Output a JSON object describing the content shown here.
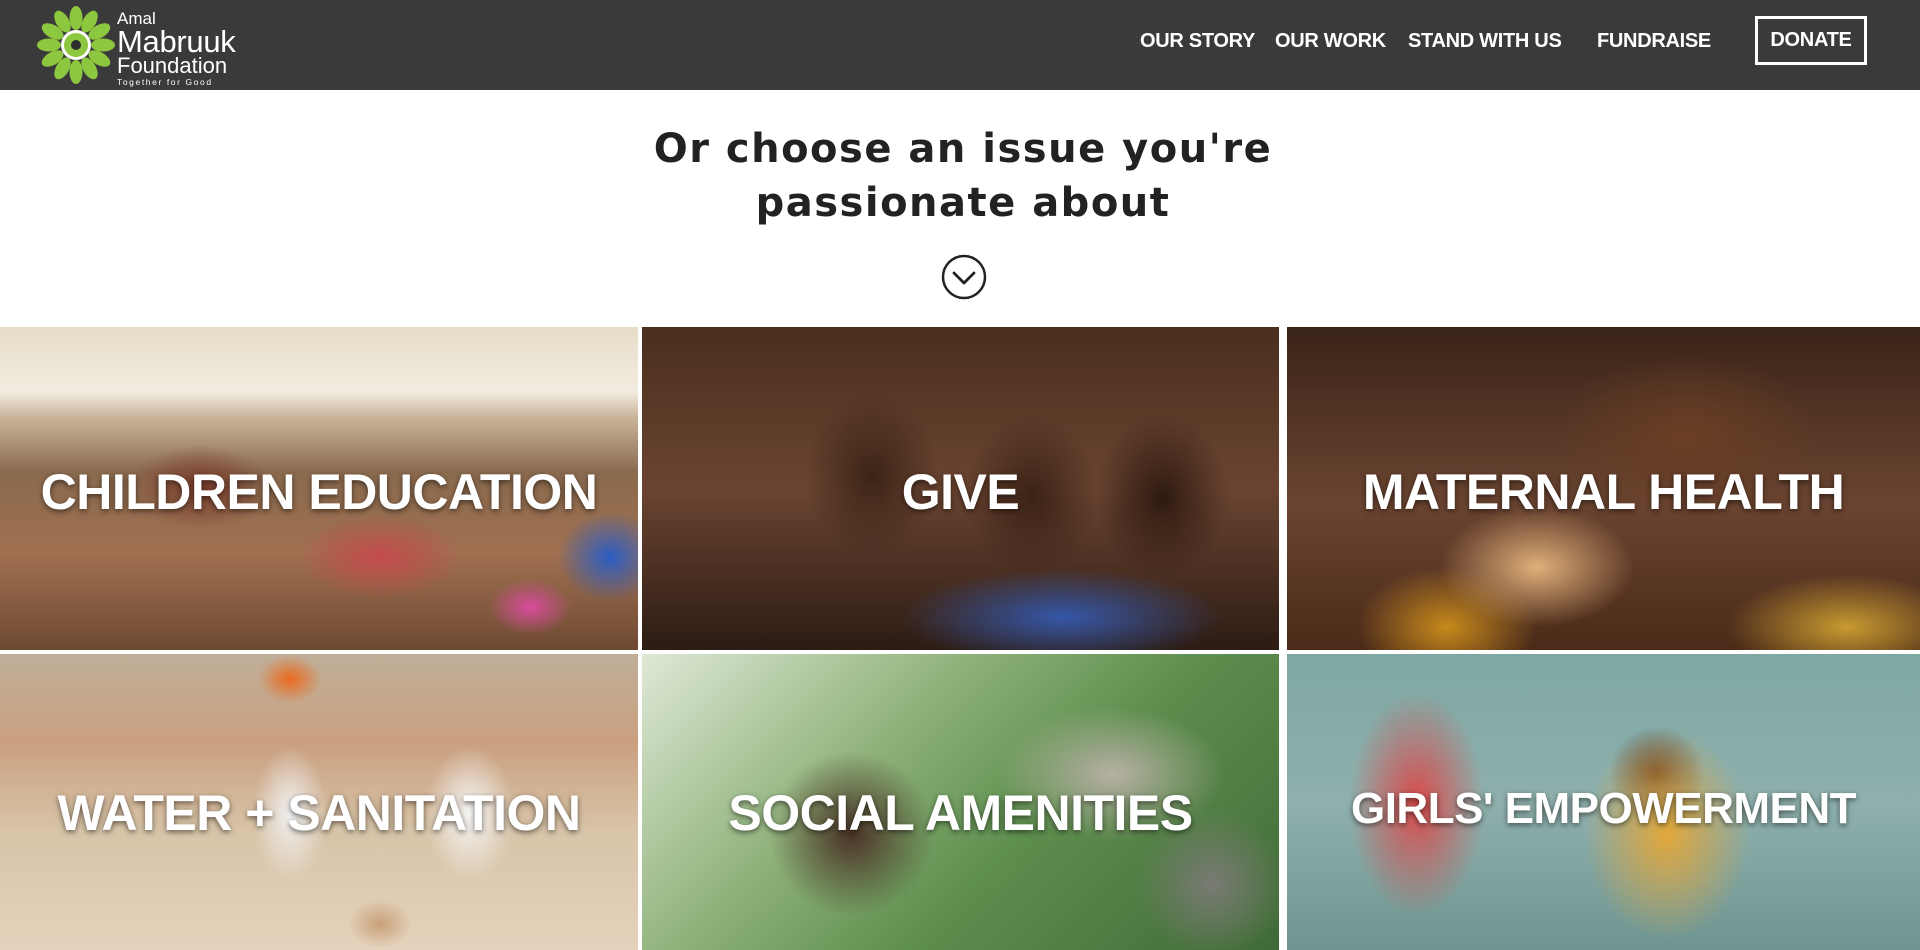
{
  "header": {
    "logo": {
      "line1": "Amal",
      "line2": "Mabruuk",
      "line3": "Foundation",
      "tagline": "Together for Good",
      "icon": "sunflower-logo-icon"
    },
    "nav": [
      "OUR STORY",
      "OUR WORK",
      "STAND WITH US",
      "FUNDRAISE"
    ],
    "donate_label": "DONATE",
    "background_color": "#3a3a3a",
    "logo_accent_color": "#8dc63f"
  },
  "main": {
    "heading_line1": "Or choose an issue you're",
    "heading_line2": "passionate about",
    "scroll_icon": "chevron-down-circle-icon"
  },
  "tiles": [
    {
      "label": "CHILDREN EDUCATION"
    },
    {
      "label": "GIVE"
    },
    {
      "label": "MATERNAL HEALTH"
    },
    {
      "label": "WATER + SANITATION"
    },
    {
      "label": "SOCIAL AMENITIES"
    },
    {
      "label": "GIRLS' EMPOWERMENT"
    }
  ]
}
